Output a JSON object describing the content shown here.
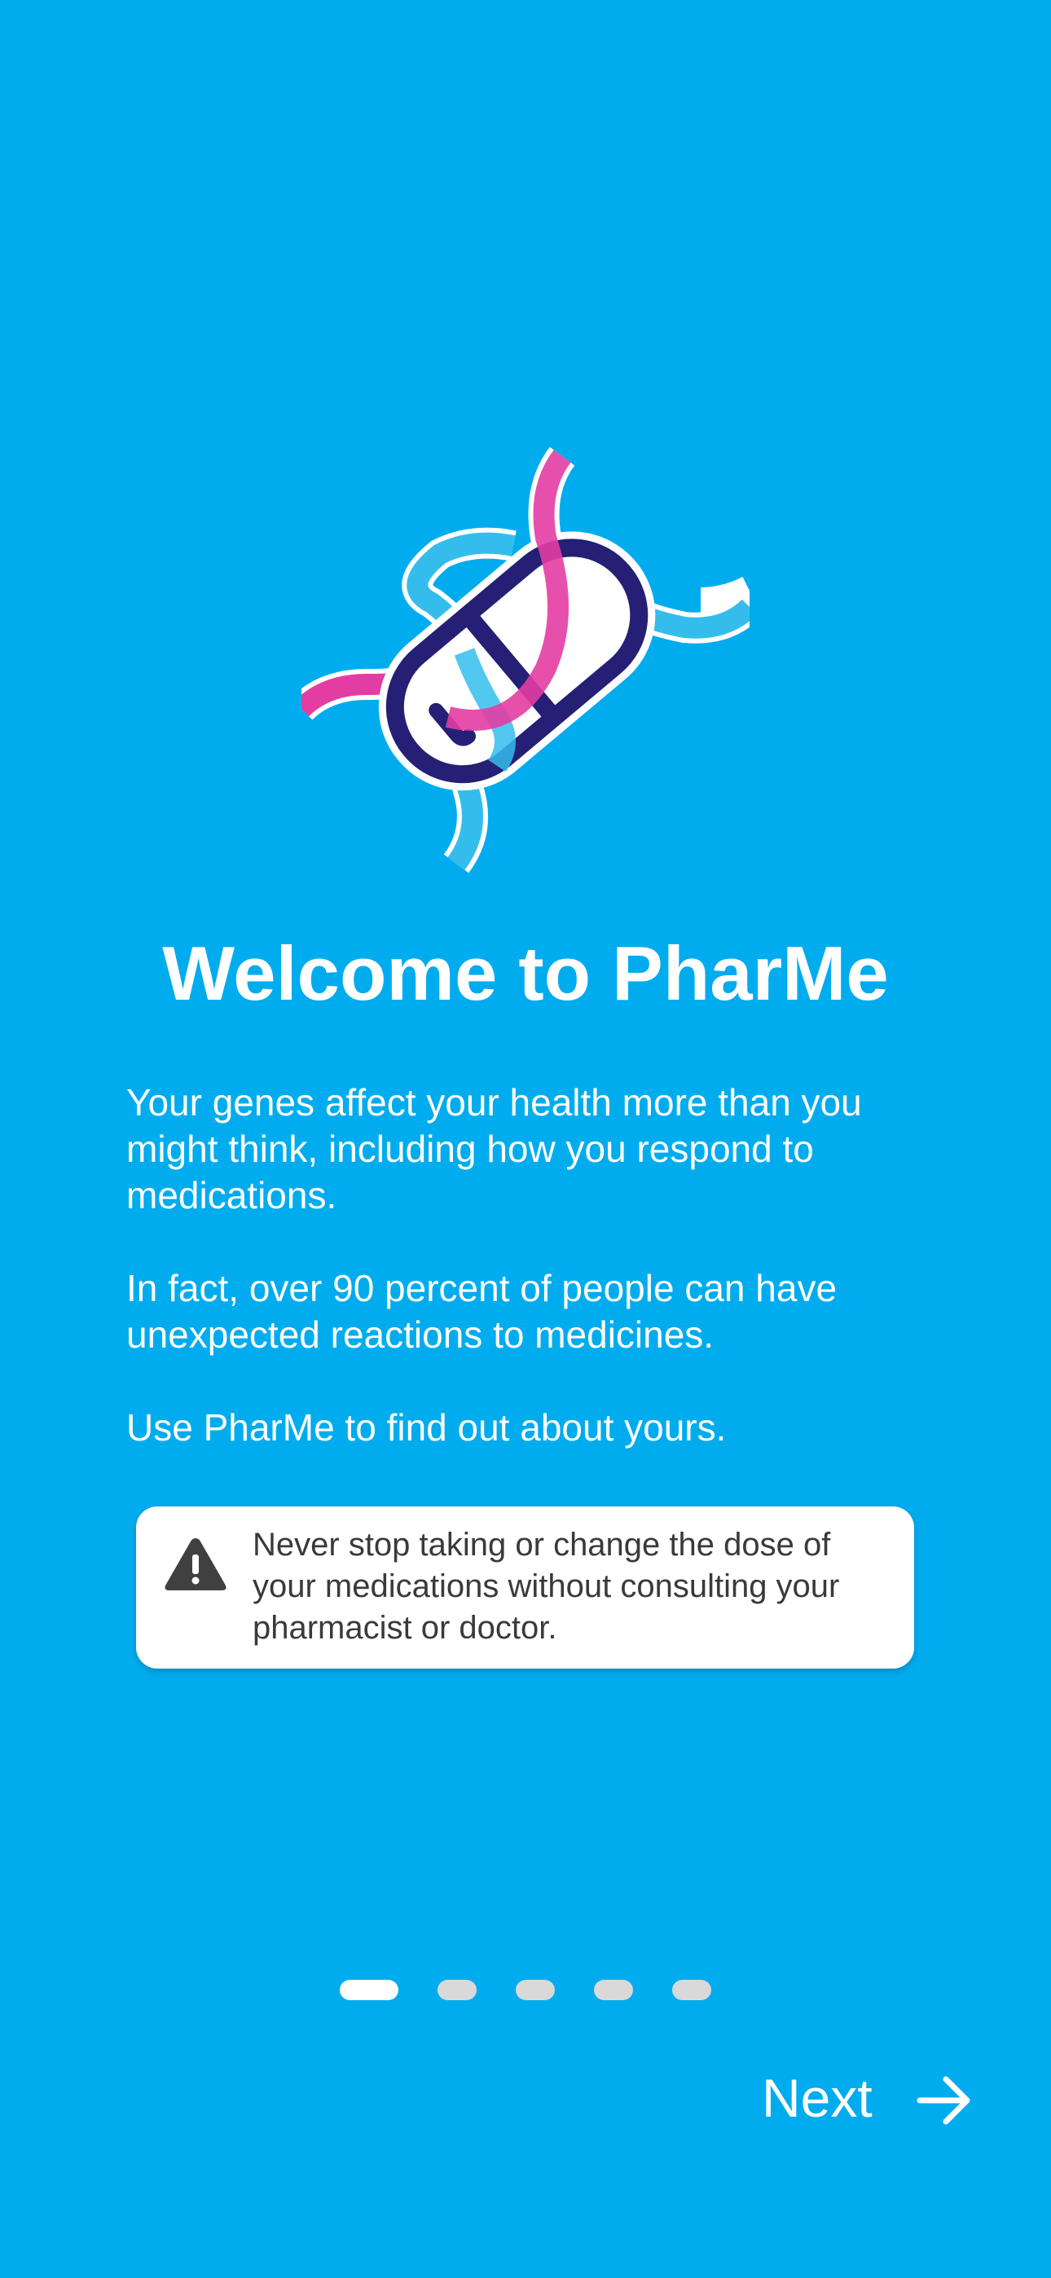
{
  "onboarding": {
    "title": "Welcome to PharMe",
    "paragraphs": [
      "Your genes affect your health more than you might think, including how you respond to medications.",
      "In fact, over 90 percent of people can have unexpected reactions to medicines.",
      "Use PharMe to find out about yours."
    ],
    "warning": {
      "icon": "warning-triangle-icon",
      "text": "Never stop taking or change the dose of your medications without consulting your pharmacist or doctor."
    },
    "pagination": {
      "total_pages": 5,
      "current_page": 1
    },
    "next_button": {
      "label": "Next",
      "icon": "arrow-right-icon"
    }
  },
  "logo": {
    "icon": "pharme-logo-icon"
  },
  "colors": {
    "background": "#00acee",
    "pink_strand": "#e33da3",
    "blue_strand": "#34bdec",
    "pill_outline": "#252075",
    "card": "#ffffff",
    "warning_icon": "#404040",
    "dot_active": "#ffffff",
    "dot_inactive": "#d9d9d9"
  }
}
